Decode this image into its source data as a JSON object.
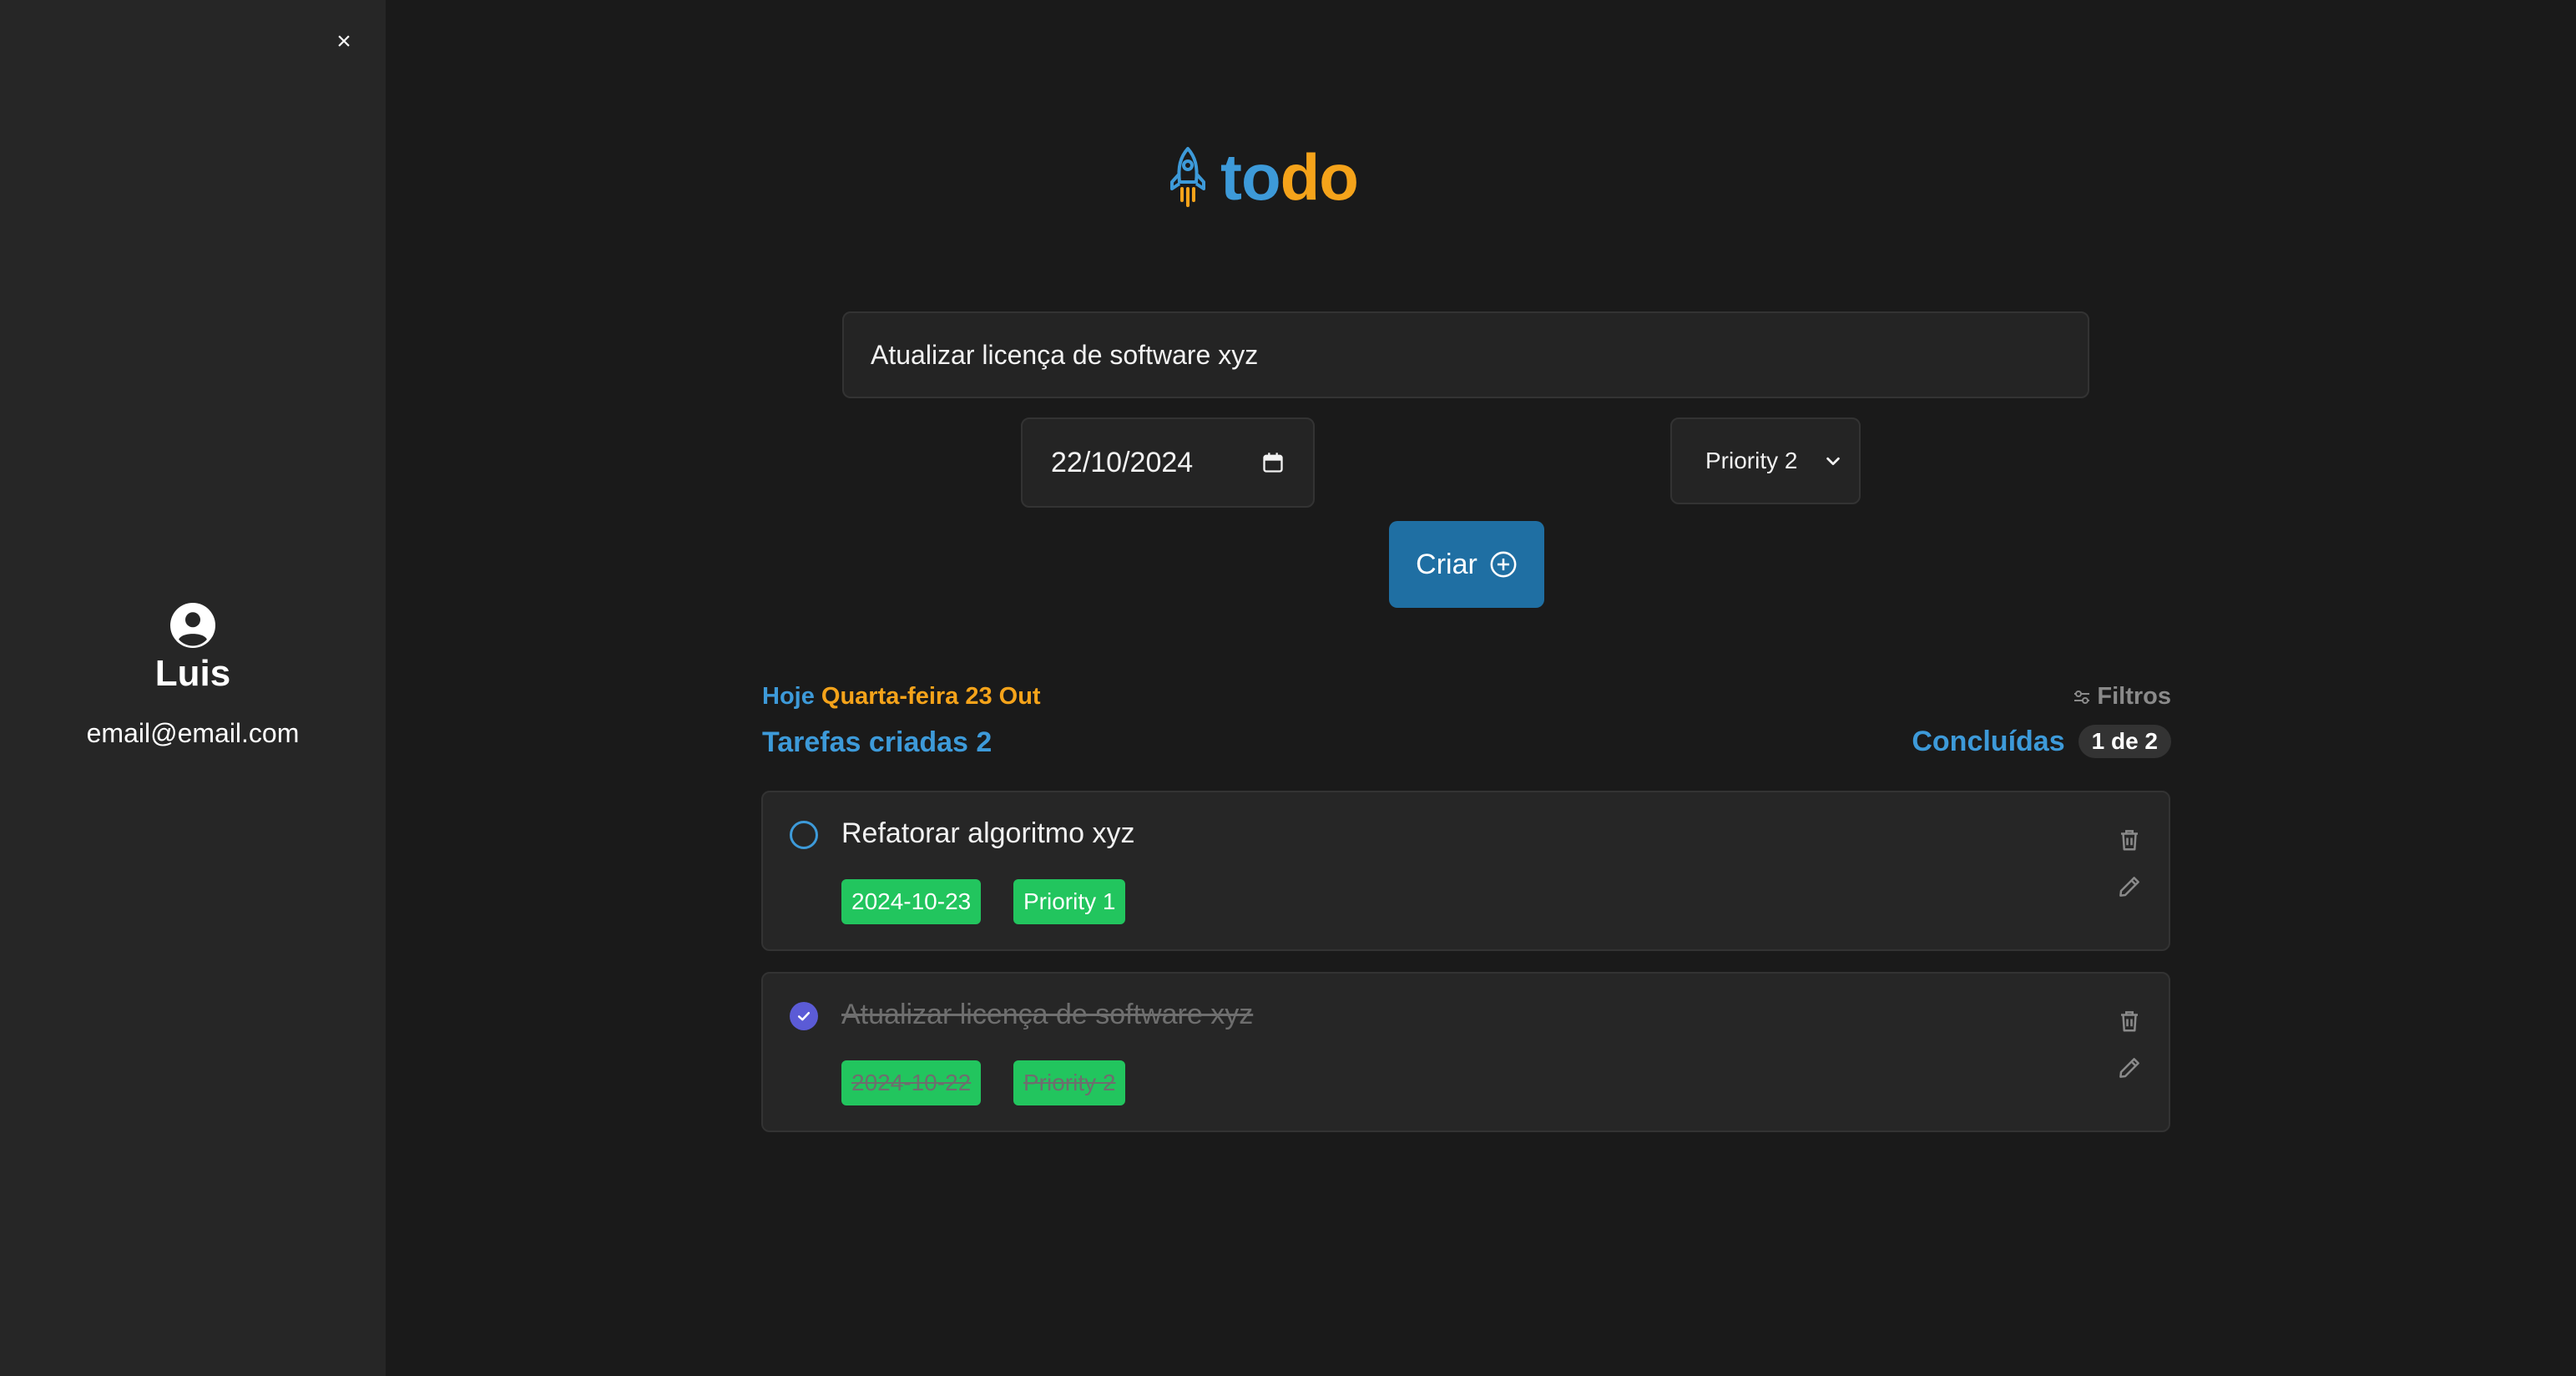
{
  "sidebar": {
    "close_label": "×",
    "user_name": "Luis",
    "user_email": "email@email.com",
    "icons": {
      "close": "close-icon",
      "avatar": "user-circle-icon"
    }
  },
  "logo": {
    "part1": "to",
    "part2": "do",
    "icon": "rocket-icon",
    "colors": {
      "to": "#3d9ad9",
      "do": "#f5a31a"
    }
  },
  "form": {
    "task_value": "Atualizar licença de software xyz",
    "date_value": "22/10/2024",
    "priority_selected": "Priority 2",
    "create_label": "Criar"
  },
  "summary": {
    "today_label": "Hoje",
    "today_date": "Quarta-feira 23 Out",
    "filters_label": "Filtros",
    "created_label": "Tarefas criadas 2",
    "done_label": "Concluídas",
    "done_count": "1 de 2"
  },
  "tasks": [
    {
      "title": "Refatorar algoritmo xyz",
      "date": "2024-10-23",
      "priority": "Priority 1",
      "completed": false
    },
    {
      "title": "Atualizar licença de software xyz",
      "date": "2024-10-22",
      "priority": "Priority 2",
      "completed": true
    }
  ],
  "colors": {
    "accent": "#3d9ad9",
    "orange": "#f5a31a",
    "button": "#1f6fa3",
    "tag": "#22c55e",
    "check_done": "#5b5bd6"
  }
}
